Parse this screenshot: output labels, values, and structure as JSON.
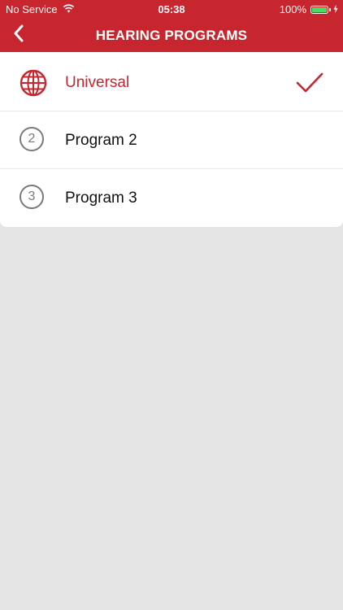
{
  "status_bar": {
    "carrier": "No Service",
    "time": "05:38",
    "battery": "100%"
  },
  "nav": {
    "title": "HEARING PROGRAMS",
    "back_icon": "chevron-left-icon"
  },
  "programs": [
    {
      "label": "Universal",
      "icon": "globe-icon",
      "selected": true
    },
    {
      "label": "Program 2",
      "number": "2",
      "selected": false
    },
    {
      "label": "Program 3",
      "number": "3",
      "selected": false
    }
  ],
  "colors": {
    "accent": "#c8262e",
    "background": "#e5e5e5",
    "row_background": "#ffffff",
    "number_icon": "#7a7a7a"
  }
}
